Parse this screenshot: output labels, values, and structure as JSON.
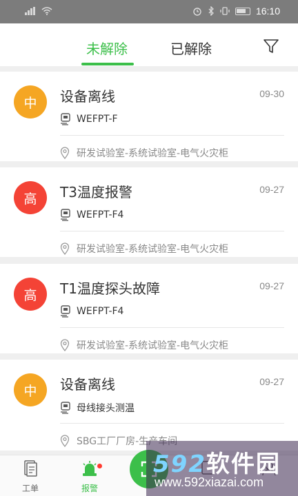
{
  "statusbar": {
    "time": "16:10"
  },
  "tabs": {
    "active": "未解除",
    "inactive": "已解除"
  },
  "alarms": [
    {
      "level": "中",
      "color": "#f5a623",
      "title": "设备离线",
      "date": "09-30",
      "device": "WEFPT-F",
      "location": "研发试验室-系统试验室-电气火灾柜"
    },
    {
      "level": "高",
      "color": "#f44336",
      "title": "T3温度报警",
      "date": "09-27",
      "device": "WEFPT-F4",
      "location": "研发试验室-系统试验室-电气火灾柜"
    },
    {
      "level": "高",
      "color": "#f44336",
      "title": "T1温度探头故障",
      "date": "09-27",
      "device": "WEFPT-F4",
      "location": "研发试验室-系统试验室-电气火灾柜"
    },
    {
      "level": "中",
      "color": "#f5a623",
      "title": "设备离线",
      "date": "09-27",
      "device": "母线接头测温",
      "location": "SBG工厂厂房-生产车间"
    }
  ],
  "bottomnav": {
    "work": "工单",
    "alarm": "报警"
  },
  "watermark": {
    "brand_num": "592",
    "brand_text": "软件园",
    "url": "www.592xiazai.com"
  },
  "colors": {
    "accent": "#3cbf4a",
    "high": "#f44336",
    "medium": "#f5a623"
  }
}
